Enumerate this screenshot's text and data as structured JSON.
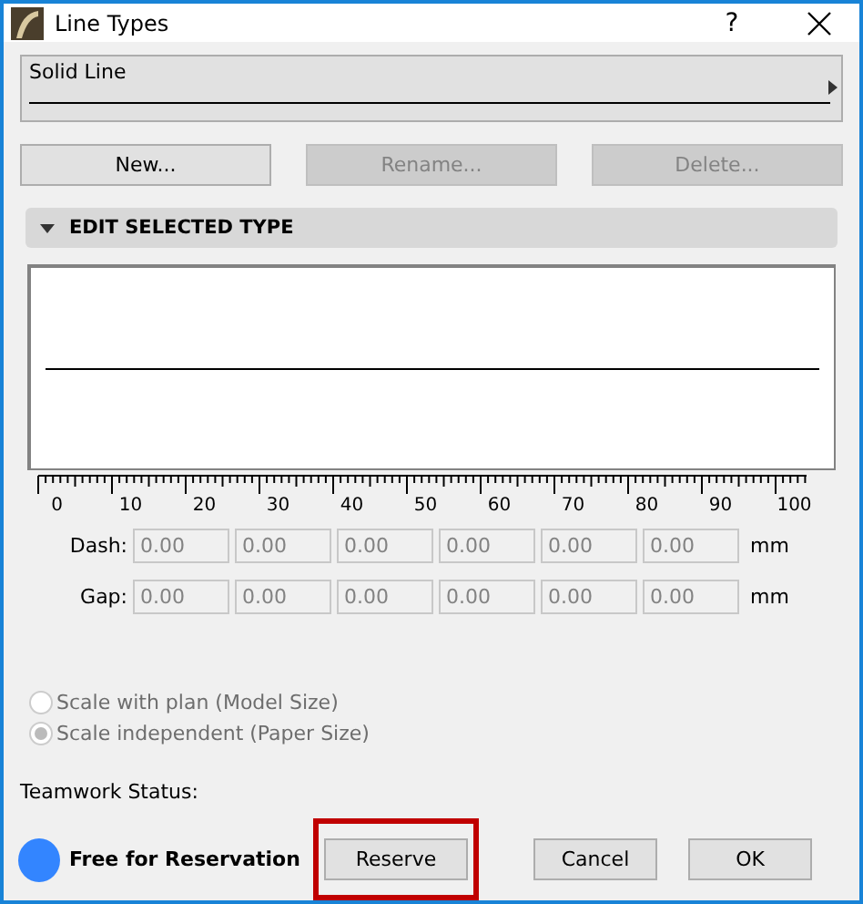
{
  "window": {
    "title": "Line Types",
    "help": "?"
  },
  "selector": {
    "value": "Solid Line"
  },
  "buttons": [
    {
      "label": "New...",
      "disabled": false
    },
    {
      "label": "Rename...",
      "disabled": true
    },
    {
      "label": "Delete...",
      "disabled": true
    }
  ],
  "section": {
    "title": "EDIT SELECTED TYPE",
    "expanded": true
  },
  "ruler": {
    "labels": [
      "0",
      "10",
      "20",
      "30",
      "40",
      "50",
      "60",
      "70",
      "80",
      "90",
      "100"
    ]
  },
  "rows": [
    {
      "label": "Dash:",
      "values": [
        "0.00",
        "0.00",
        "0.00",
        "0.00",
        "0.00",
        "0.00"
      ],
      "unit": "mm"
    },
    {
      "label": "Gap:",
      "values": [
        "0.00",
        "0.00",
        "0.00",
        "0.00",
        "0.00",
        "0.00"
      ],
      "unit": "mm"
    }
  ],
  "scale_options": [
    {
      "label": "Scale with plan (Model Size)",
      "selected": false,
      "disabled": true
    },
    {
      "label": "Scale independent (Paper Size)",
      "selected": true,
      "disabled": true
    }
  ],
  "teamwork": {
    "label": "Teamwork Status:",
    "status": "Free for Reservation",
    "color": "#3385ff"
  },
  "footer_buttons": [
    {
      "label": "Reserve",
      "highlighted": true
    },
    {
      "label": "Cancel",
      "highlighted": false
    },
    {
      "label": "OK",
      "highlighted": false
    }
  ]
}
